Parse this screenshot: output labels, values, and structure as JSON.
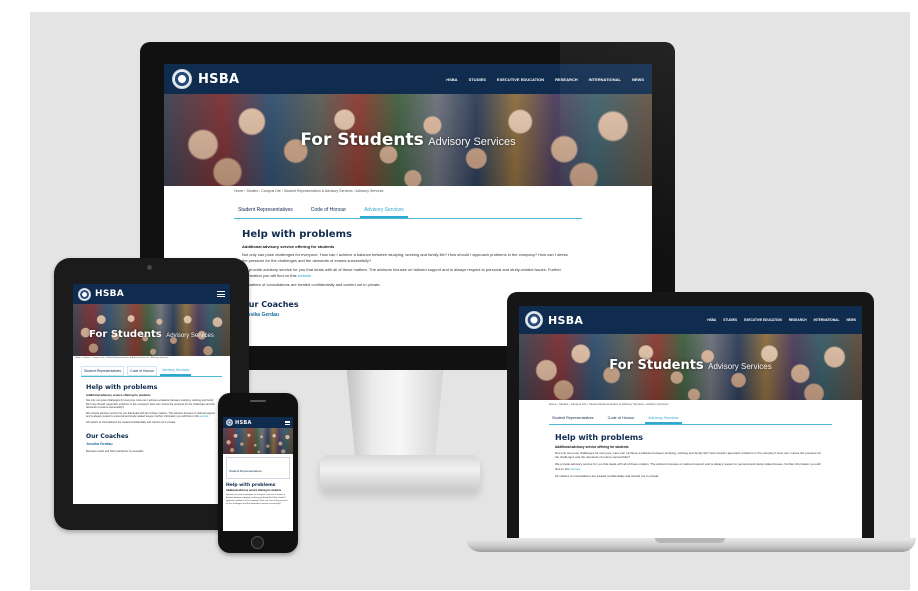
{
  "site": {
    "brand": "HSBA",
    "nav_links": [
      "HSBA",
      "STUDIES",
      "EXECUTIVE EDUCATION",
      "RESEARCH",
      "INTERNATIONAL",
      "NEWS"
    ],
    "hero_title_bold": "For Students",
    "hero_title_light": "Advisory Services",
    "breadcrumb": "Home › Studies › Campus Life › Student Representation & Advisory Services › Advisory Services",
    "tabs": [
      "Student Representatives",
      "Code of Honour",
      "Advisory Services"
    ],
    "active_tab": "Advisory Services",
    "heading": "Help with problems",
    "subheading": "Additional advisory service offering for students",
    "para1": "Not only can pose challenges for everyone. How can I achieve a balance between studying, working and family life? How should I approach problems in the company? How can I stress the pressure for the challenges and the demands of exams successfully?",
    "para2": "We provide advisory service for you that deals with all of these matters. The advisors focuses on tailored support and is always respect to personal and study-related issues. Further information you will find on this",
    "link_text": "website",
    "para3": "All matters of consultations are treated confidentially and carried out in private.",
    "coaches_heading": "Our Coaches",
    "coach_name": "Jessika Gerdau",
    "coach_title": "Business coach and NLP practitioner & counsellor"
  },
  "colors": {
    "navy": "#0f2b4e",
    "accent": "#2fa7cf"
  }
}
